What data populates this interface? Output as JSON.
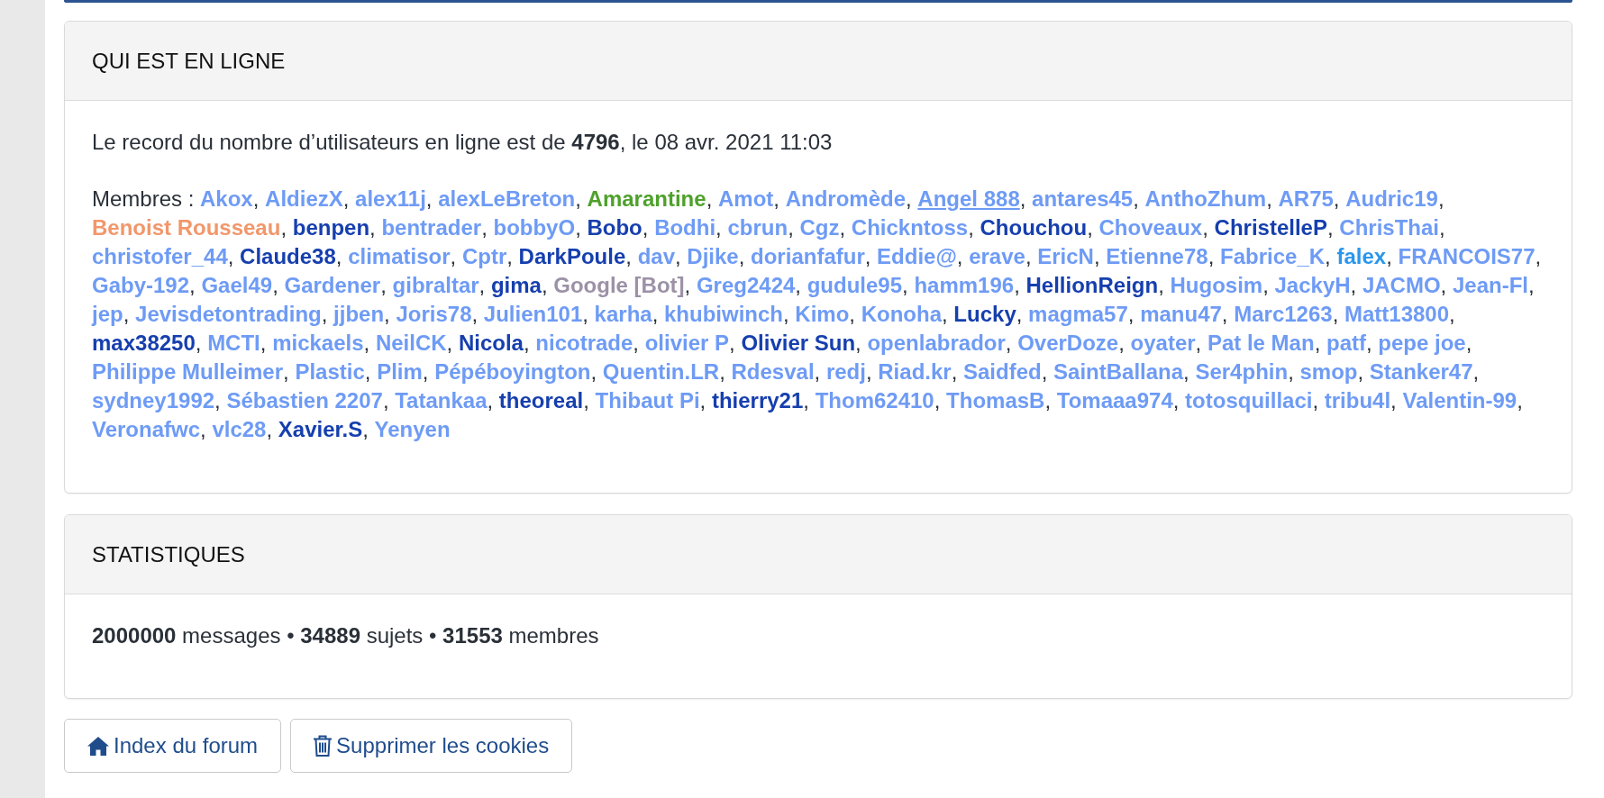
{
  "online": {
    "title": "QUI EST EN LIGNE",
    "record": "Le record du nombre d’utilisateurs en ligne est de **4796**, le 08 avr. 2021 11:03",
    "members_label": "Membres :",
    "separator": ",",
    "members": [
      {
        "name": "Akox",
        "color": "#6e9bf5",
        "hovered": false
      },
      {
        "name": "AldiezX",
        "color": "#6e9bf5",
        "hovered": false
      },
      {
        "name": "alex11j",
        "color": "#6e9bf5",
        "hovered": false
      },
      {
        "name": "alexLeBreton",
        "color": "#6e9bf5",
        "hovered": false
      },
      {
        "name": "Amarantine",
        "color": "#4ea12b",
        "hovered": false
      },
      {
        "name": "Amot",
        "color": "#6e9bf5",
        "hovered": false
      },
      {
        "name": "Andromède",
        "color": "#6e9bf5",
        "hovered": false
      },
      {
        "name": "Angel 888",
        "color": "#6e9bf5",
        "hovered": true
      },
      {
        "name": "antares45",
        "color": "#6e9bf5",
        "hovered": false
      },
      {
        "name": "AnthoZhum",
        "color": "#6e9bf5",
        "hovered": false
      },
      {
        "name": "AR75",
        "color": "#6e9bf5",
        "hovered": false
      },
      {
        "name": "Audric19",
        "color": "#6e9bf5",
        "hovered": false
      },
      {
        "name": "Benoist Rousseau",
        "color": "#f1976b",
        "hovered": false
      },
      {
        "name": "benpen",
        "color": "#163fae",
        "hovered": false
      },
      {
        "name": "bentrader",
        "color": "#6e9bf5",
        "hovered": false
      },
      {
        "name": "bobbyO",
        "color": "#6e9bf5",
        "hovered": false
      },
      {
        "name": "Bobo",
        "color": "#163fae",
        "hovered": false
      },
      {
        "name": "Bodhi",
        "color": "#6e9bf5",
        "hovered": false
      },
      {
        "name": "cbrun",
        "color": "#6e9bf5",
        "hovered": false
      },
      {
        "name": "Cgz",
        "color": "#6e9bf5",
        "hovered": false
      },
      {
        "name": "Chickntoss",
        "color": "#6e9bf5",
        "hovered": false
      },
      {
        "name": "Chouchou",
        "color": "#163fae",
        "hovered": false
      },
      {
        "name": "Choveaux",
        "color": "#6e9bf5",
        "hovered": false
      },
      {
        "name": "ChristelleP",
        "color": "#163fae",
        "hovered": false
      },
      {
        "name": "ChrisThai",
        "color": "#6e9bf5",
        "hovered": false
      },
      {
        "name": "christofer_44",
        "color": "#6e9bf5",
        "hovered": false
      },
      {
        "name": "Claude38",
        "color": "#163fae",
        "hovered": false
      },
      {
        "name": "climatisor",
        "color": "#6e9bf5",
        "hovered": false
      },
      {
        "name": "Cptr",
        "color": "#6e9bf5",
        "hovered": false
      },
      {
        "name": "DarkPoule",
        "color": "#163fae",
        "hovered": false
      },
      {
        "name": "dav",
        "color": "#6e9bf5",
        "hovered": false
      },
      {
        "name": "Djike",
        "color": "#6e9bf5",
        "hovered": false
      },
      {
        "name": "dorianfafur",
        "color": "#6e9bf5",
        "hovered": false
      },
      {
        "name": "Eddie@",
        "color": "#6e9bf5",
        "hovered": false
      },
      {
        "name": "erave",
        "color": "#6e9bf5",
        "hovered": false
      },
      {
        "name": "EricN",
        "color": "#6e9bf5",
        "hovered": false
      },
      {
        "name": "Etienne78",
        "color": "#6e9bf5",
        "hovered": false
      },
      {
        "name": "Fabrice_K",
        "color": "#6e9bf5",
        "hovered": false
      },
      {
        "name": "falex",
        "color": "#2a97ec",
        "hovered": false
      },
      {
        "name": "FRANCOIS77",
        "color": "#6e9bf5",
        "hovered": false
      },
      {
        "name": "Gaby-192",
        "color": "#6e9bf5",
        "hovered": false
      },
      {
        "name": "Gael49",
        "color": "#6e9bf5",
        "hovered": false
      },
      {
        "name": "Gardener",
        "color": "#6e9bf5",
        "hovered": false
      },
      {
        "name": "gibraltar",
        "color": "#6e9bf5",
        "hovered": false
      },
      {
        "name": "gima",
        "color": "#163fae",
        "hovered": false
      },
      {
        "name": "Google [Bot]",
        "color": "#9c91a6",
        "hovered": false
      },
      {
        "name": "Greg2424",
        "color": "#6e9bf5",
        "hovered": false
      },
      {
        "name": "gudule95",
        "color": "#6e9bf5",
        "hovered": false
      },
      {
        "name": "hamm196",
        "color": "#6e9bf5",
        "hovered": false
      },
      {
        "name": "HellionReign",
        "color": "#163fae",
        "hovered": false
      },
      {
        "name": "Hugosim",
        "color": "#6e9bf5",
        "hovered": false
      },
      {
        "name": "JackyH",
        "color": "#6e9bf5",
        "hovered": false
      },
      {
        "name": "JACMO",
        "color": "#6e9bf5",
        "hovered": false
      },
      {
        "name": "Jean-Fl",
        "color": "#6e9bf5",
        "hovered": false
      },
      {
        "name": "jep",
        "color": "#6e9bf5",
        "hovered": false
      },
      {
        "name": "Jevisdetontrading",
        "color": "#6e9bf5",
        "hovered": false
      },
      {
        "name": "jjben",
        "color": "#6e9bf5",
        "hovered": false
      },
      {
        "name": "Joris78",
        "color": "#6e9bf5",
        "hovered": false
      },
      {
        "name": "Julien101",
        "color": "#6e9bf5",
        "hovered": false
      },
      {
        "name": "karha",
        "color": "#6e9bf5",
        "hovered": false
      },
      {
        "name": "khubiwinch",
        "color": "#6e9bf5",
        "hovered": false
      },
      {
        "name": "Kimo",
        "color": "#6e9bf5",
        "hovered": false
      },
      {
        "name": "Konoha",
        "color": "#6e9bf5",
        "hovered": false
      },
      {
        "name": "Lucky",
        "color": "#163fae",
        "hovered": false
      },
      {
        "name": "magma57",
        "color": "#6e9bf5",
        "hovered": false
      },
      {
        "name": "manu47",
        "color": "#6e9bf5",
        "hovered": false
      },
      {
        "name": "Marc1263",
        "color": "#6e9bf5",
        "hovered": false
      },
      {
        "name": "Matt13800",
        "color": "#6e9bf5",
        "hovered": false
      },
      {
        "name": "max38250",
        "color": "#163fae",
        "hovered": false
      },
      {
        "name": "MCTI",
        "color": "#6e9bf5",
        "hovered": false
      },
      {
        "name": "mickaels",
        "color": "#6e9bf5",
        "hovered": false
      },
      {
        "name": "NeilCK",
        "color": "#6e9bf5",
        "hovered": false
      },
      {
        "name": "Nicola",
        "color": "#163fae",
        "hovered": false
      },
      {
        "name": "nicotrade",
        "color": "#6e9bf5",
        "hovered": false
      },
      {
        "name": "olivier P",
        "color": "#6e9bf5",
        "hovered": false
      },
      {
        "name": "Olivier Sun",
        "color": "#163fae",
        "hovered": false
      },
      {
        "name": "openlabrador",
        "color": "#6e9bf5",
        "hovered": false
      },
      {
        "name": "OverDoze",
        "color": "#6e9bf5",
        "hovered": false
      },
      {
        "name": "oyater",
        "color": "#6e9bf5",
        "hovered": false
      },
      {
        "name": "Pat le Man",
        "color": "#6e9bf5",
        "hovered": false
      },
      {
        "name": "patf",
        "color": "#6e9bf5",
        "hovered": false
      },
      {
        "name": "pepe joe",
        "color": "#6e9bf5",
        "hovered": false
      },
      {
        "name": "Philippe Mulleimer",
        "color": "#6e9bf5",
        "hovered": false
      },
      {
        "name": "Plastic",
        "color": "#6e9bf5",
        "hovered": false
      },
      {
        "name": "Plim",
        "color": "#6e9bf5",
        "hovered": false
      },
      {
        "name": "Pépéboyington",
        "color": "#6e9bf5",
        "hovered": false
      },
      {
        "name": "Quentin.LR",
        "color": "#6e9bf5",
        "hovered": false
      },
      {
        "name": "Rdesval",
        "color": "#6e9bf5",
        "hovered": false
      },
      {
        "name": "redj",
        "color": "#6e9bf5",
        "hovered": false
      },
      {
        "name": "Riad.kr",
        "color": "#6e9bf5",
        "hovered": false
      },
      {
        "name": "Saidfed",
        "color": "#6e9bf5",
        "hovered": false
      },
      {
        "name": "SaintBallana",
        "color": "#6e9bf5",
        "hovered": false
      },
      {
        "name": "Ser4phin",
        "color": "#6e9bf5",
        "hovered": false
      },
      {
        "name": "smop",
        "color": "#6e9bf5",
        "hovered": false
      },
      {
        "name": "Stanker47",
        "color": "#6e9bf5",
        "hovered": false
      },
      {
        "name": "sydney1992",
        "color": "#6e9bf5",
        "hovered": false
      },
      {
        "name": "Sébastien 2207",
        "color": "#6e9bf5",
        "hovered": false
      },
      {
        "name": "Tatankaa",
        "color": "#6e9bf5",
        "hovered": false
      },
      {
        "name": "theoreal",
        "color": "#163fae",
        "hovered": false
      },
      {
        "name": "Thibaut Pi",
        "color": "#6e9bf5",
        "hovered": false
      },
      {
        "name": "thierry21",
        "color": "#163fae",
        "hovered": false
      },
      {
        "name": "Thom62410",
        "color": "#6e9bf5",
        "hovered": false
      },
      {
        "name": "ThomasB",
        "color": "#6e9bf5",
        "hovered": false
      },
      {
        "name": "Tomaaa974",
        "color": "#6e9bf5",
        "hovered": false
      },
      {
        "name": "totosquillaci",
        "color": "#6e9bf5",
        "hovered": false
      },
      {
        "name": "tribu4l",
        "color": "#6e9bf5",
        "hovered": false
      },
      {
        "name": "Valentin-99",
        "color": "#6e9bf5",
        "hovered": false
      },
      {
        "name": "Veronafwc",
        "color": "#6e9bf5",
        "hovered": false
      },
      {
        "name": "vlc28",
        "color": "#6e9bf5",
        "hovered": false
      },
      {
        "name": "Xavier.S",
        "color": "#163fae",
        "hovered": false
      },
      {
        "name": "Yenyen",
        "color": "#6e9bf5",
        "hovered": false
      }
    ]
  },
  "statistics": {
    "title": "STATISTIQUES",
    "text": "**2000000** messages • **34889** sujets • **31553** membres"
  },
  "buttons": [
    {
      "kind": "home",
      "label": "Index du forum"
    },
    {
      "kind": "trash",
      "label": "Supprimer les cookies"
    }
  ]
}
